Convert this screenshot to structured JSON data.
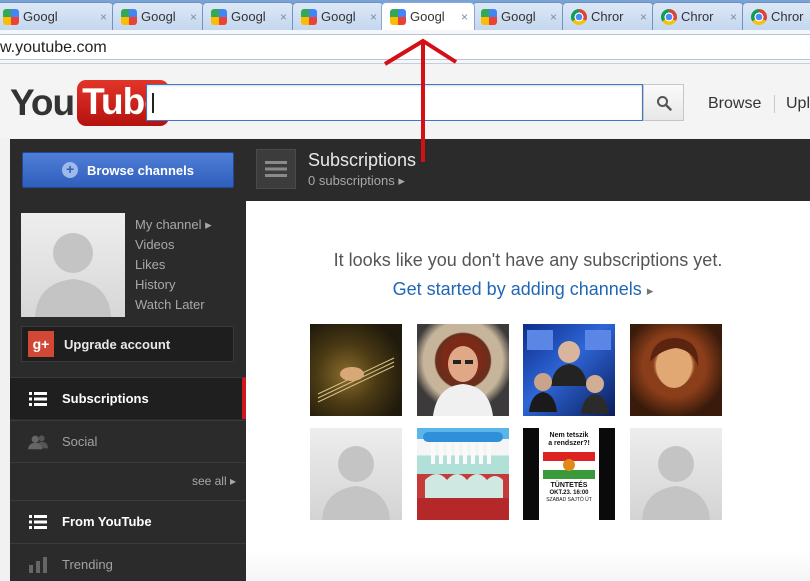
{
  "browser": {
    "tabs": [
      {
        "label": "Googl",
        "favicon": "google-icon",
        "active": false
      },
      {
        "label": "Googl",
        "favicon": "google-icon",
        "active": false
      },
      {
        "label": "Googl",
        "favicon": "google-icon",
        "active": false
      },
      {
        "label": "Googl",
        "favicon": "google-icon",
        "active": false
      },
      {
        "label": "Googl",
        "favicon": "google-icon",
        "active": true
      },
      {
        "label": "Googl",
        "favicon": "google-icon",
        "active": false
      },
      {
        "label": "Chror",
        "favicon": "chrome-icon",
        "active": false
      },
      {
        "label": "Chror",
        "favicon": "chrome-icon",
        "active": false
      },
      {
        "label": "Chror",
        "favicon": "chrome-icon",
        "active": false
      }
    ],
    "tab_close_glyph": "×",
    "address": "w.youtube.com"
  },
  "header": {
    "logo_you": "You",
    "logo_tube": "Tube",
    "search_value": "",
    "browse_label": "Browse",
    "upload_label": "Upl"
  },
  "sidebar": {
    "browse_channels_label": "Browse channels",
    "channel_links": [
      "My channel",
      "Videos",
      "Likes",
      "History",
      "Watch Later"
    ],
    "upgrade_label": "Upgrade account",
    "gplus_text": "g+",
    "nav": [
      {
        "label": "Subscriptions",
        "icon": "list-icon",
        "selected": true
      },
      {
        "label": "Social",
        "icon": "people-icon",
        "selected": false
      },
      {
        "label": "From YouTube",
        "icon": "list-icon",
        "selected": false
      },
      {
        "label": "Trending",
        "icon": "bar-chart-icon",
        "selected": false
      }
    ],
    "see_all_label": "see all"
  },
  "main": {
    "title": "Subscriptions",
    "subtitle": "0 subscriptions",
    "empty_message": "It looks like you don't have any subscriptions yet.",
    "get_started": "Get started by adding channels",
    "poster_lines": [
      "Nem tetszik",
      "a rendszer?!",
      "TÜNTETÉS",
      "OKT.23. 16:00",
      "SZABAD SAJTÓ ÚT"
    ]
  },
  "colors": {
    "brand_red": "#cc181e",
    "link_blue": "#2267b5",
    "annotation_red": "#d40f15"
  }
}
